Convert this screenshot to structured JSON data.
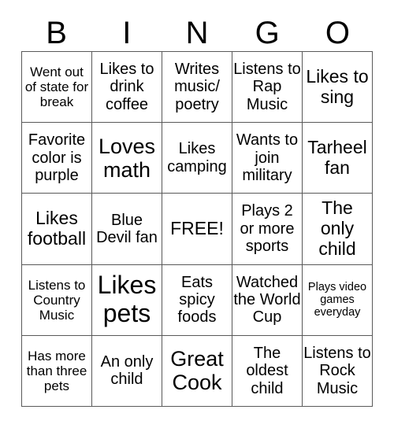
{
  "header": {
    "letters": [
      "B",
      "I",
      "N",
      "G",
      "O"
    ]
  },
  "grid": {
    "rows": 5,
    "columns": 5,
    "border_color": "#595959",
    "background_color": "#ffffff",
    "text_color": "#000000",
    "cells": [
      {
        "text": "Went out of state for break",
        "size": "fs-sm"
      },
      {
        "text": "Likes to drink coffee",
        "size": "fs-md"
      },
      {
        "text": "Writes music/ poetry",
        "size": "fs-md"
      },
      {
        "text": "Listens to Rap Music",
        "size": "fs-md"
      },
      {
        "text": "Likes to sing",
        "size": "fs-lg"
      },
      {
        "text": "Favorite color is purple",
        "size": "fs-md"
      },
      {
        "text": "Loves math",
        "size": "fs-xl"
      },
      {
        "text": "Likes camping",
        "size": "fs-md"
      },
      {
        "text": "Wants to join military",
        "size": "fs-md"
      },
      {
        "text": "Tarheel fan",
        "size": "fs-lg"
      },
      {
        "text": "Likes football",
        "size": "fs-lg"
      },
      {
        "text": "Blue Devil fan",
        "size": "fs-md"
      },
      {
        "text": "FREE!",
        "size": "fs-lg"
      },
      {
        "text": "Plays 2 or more sports",
        "size": "fs-md"
      },
      {
        "text": "The only child",
        "size": "fs-lg"
      },
      {
        "text": "Listens to Country Music",
        "size": "fs-sm"
      },
      {
        "text": "Likes pets",
        "size": "fs-xxl"
      },
      {
        "text": "Eats spicy foods",
        "size": "fs-md"
      },
      {
        "text": "Watched the World Cup",
        "size": "fs-md"
      },
      {
        "text": "Plays video games everyday",
        "size": "fs-xs"
      },
      {
        "text": "Has more than three pets",
        "size": "fs-sm"
      },
      {
        "text": "An only child",
        "size": "fs-md"
      },
      {
        "text": "Great Cook",
        "size": "fs-xl"
      },
      {
        "text": "The oldest child",
        "size": "fs-md"
      },
      {
        "text": "Listens to Rock Music",
        "size": "fs-md"
      }
    ]
  }
}
